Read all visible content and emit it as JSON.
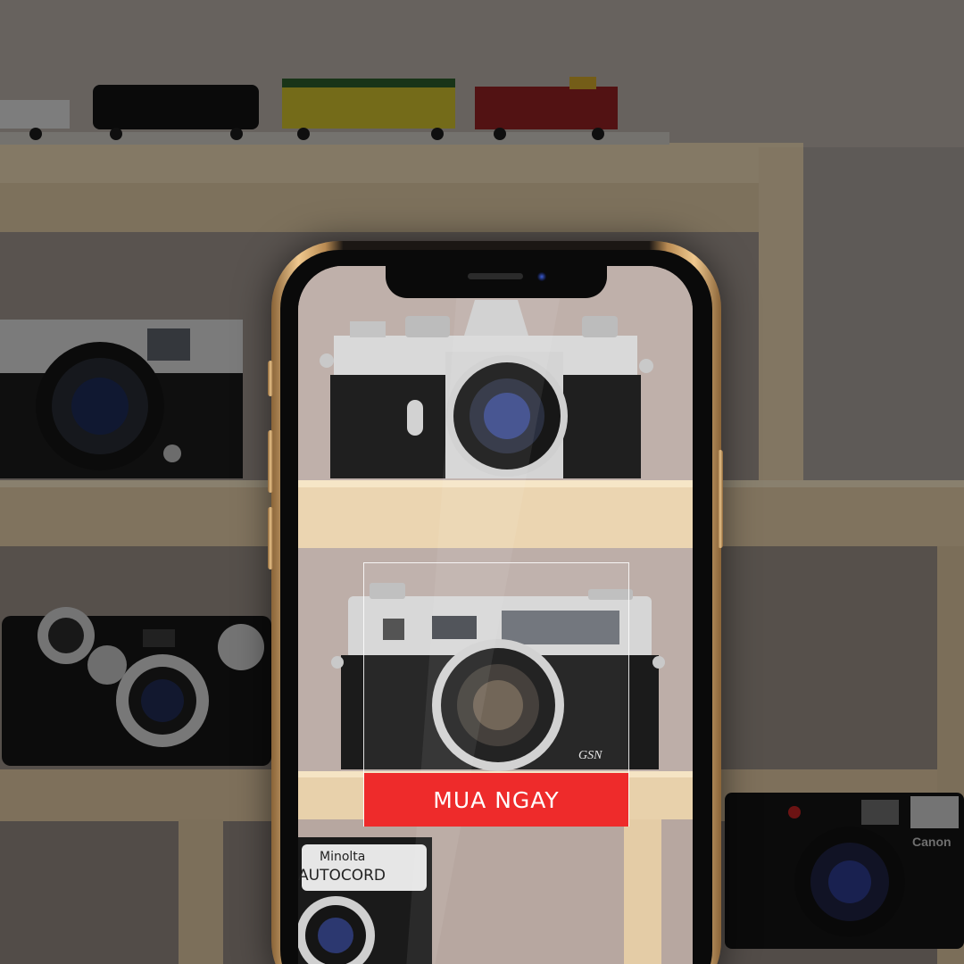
{
  "cta": {
    "label": "MUA NGAY",
    "color": "#ee2b2b"
  },
  "camera_labels": {
    "minolta_brand": "Minolta",
    "minolta_model": "AUTOCORD",
    "yashica_model": "GSN",
    "canon_brand": "Canon"
  },
  "colors": {
    "phone_gold": "#e8c188",
    "shelf_wood": "#d9c3a0"
  }
}
